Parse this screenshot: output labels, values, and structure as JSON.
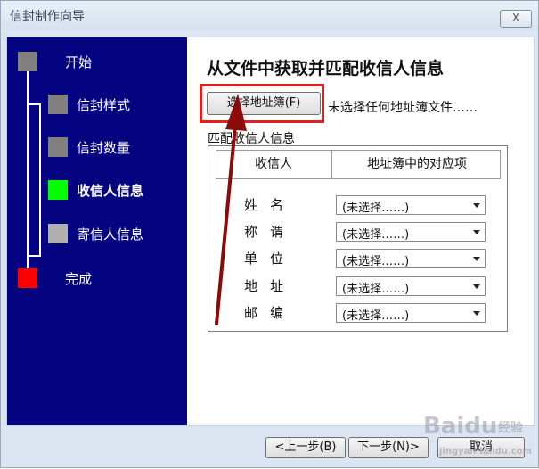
{
  "window": {
    "title": "信封制作向导",
    "close_label": "X"
  },
  "steps": [
    {
      "label": "开始",
      "color": "#808080",
      "state": "done"
    },
    {
      "label": "信封样式",
      "color": "#808080",
      "state": "done"
    },
    {
      "label": "信封数量",
      "color": "#808080",
      "state": "done"
    },
    {
      "label": "收信人信息",
      "color": "#00ff00",
      "state": "current"
    },
    {
      "label": "寄信人信息",
      "color": "#b0b0b0",
      "state": "pending"
    },
    {
      "label": "完成",
      "color": "#ff0000",
      "state": "final"
    }
  ],
  "main": {
    "title": "从文件中获取并匹配收信人信息",
    "select_address_book_button": "选择地址簿(F)",
    "no_file_text": "未选择任何地址簿文件……",
    "group_label": "匹配收信人信息",
    "columns": {
      "recipient": "收信人",
      "mapping": "地址簿中的对应项"
    },
    "fields": [
      {
        "label": "姓名",
        "value": "(未选择……)"
      },
      {
        "label": "称谓",
        "value": "(未选择……)"
      },
      {
        "label": "单位",
        "value": "(未选择……)"
      },
      {
        "label": "地址",
        "value": "(未选择……)"
      },
      {
        "label": "邮编",
        "value": "(未选择……)"
      }
    ]
  },
  "footer": {
    "back_button": "<上一步(B)",
    "next_button": "下一步(N)>",
    "cancel_button": "取消"
  },
  "annotation": {
    "highlight_color": "#e02020",
    "arrow_color": "#8b0a0a"
  },
  "watermark": {
    "brand": "Baidu",
    "sub": "经验",
    "url": "jingyan.baidu.com"
  }
}
